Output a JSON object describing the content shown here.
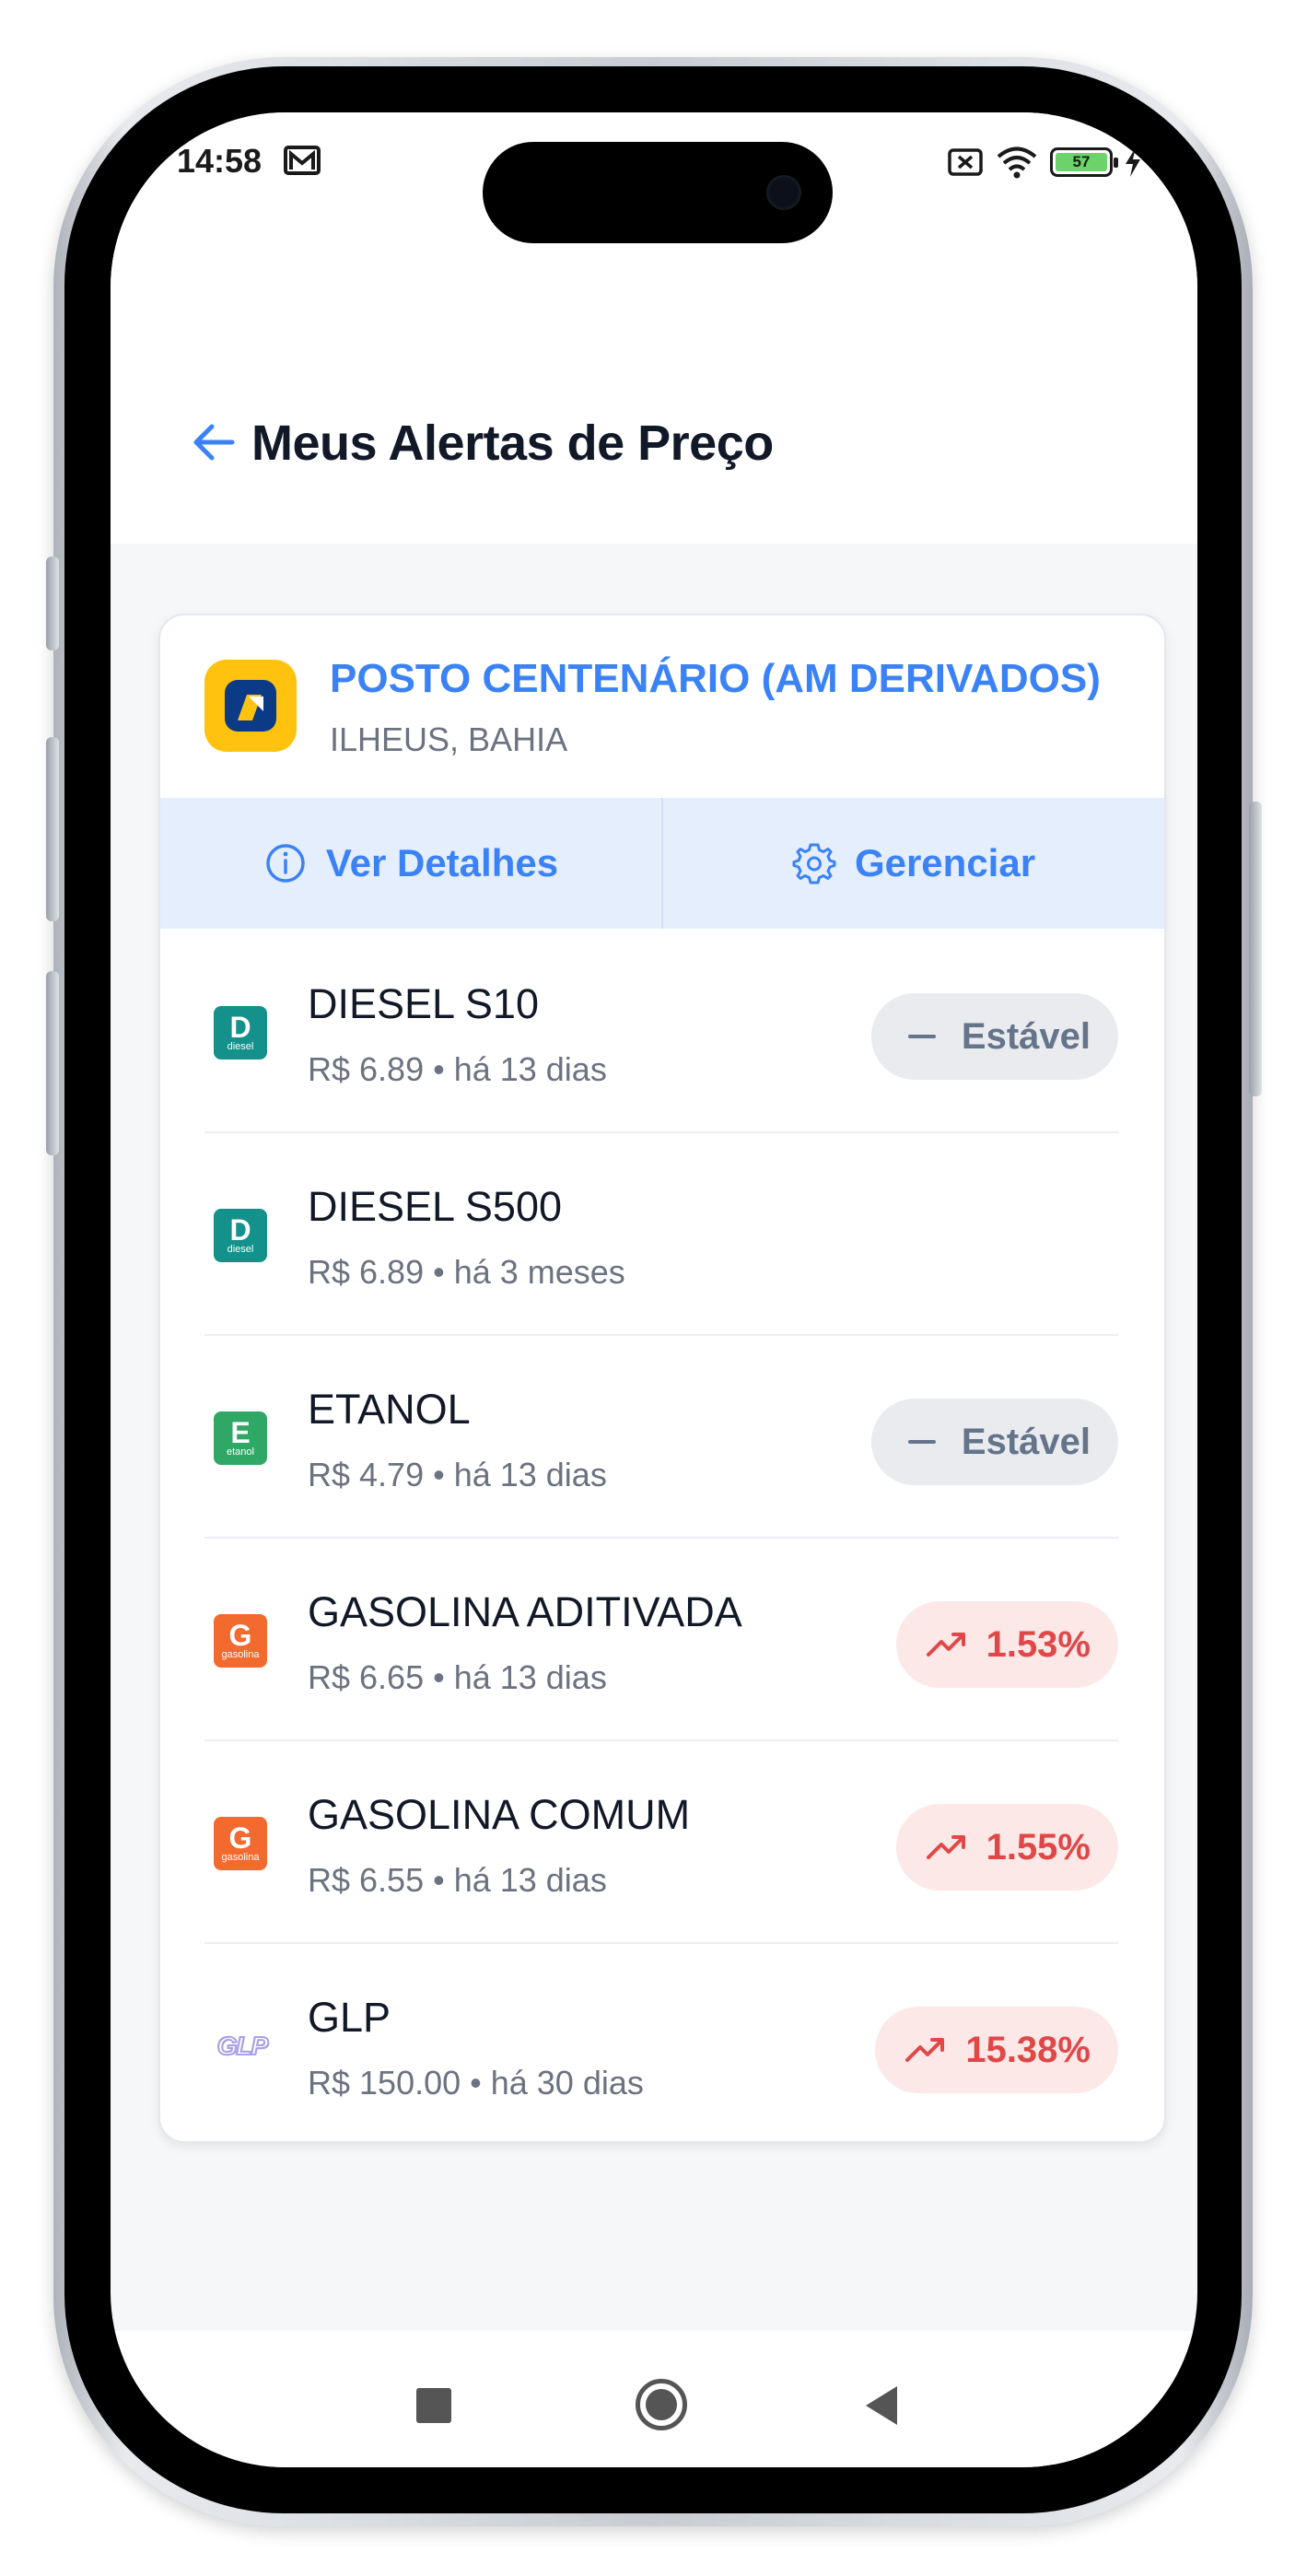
{
  "status_bar": {
    "time": "14:58",
    "battery_level": "57",
    "icons": [
      "mail-icon",
      "screen-cast-off-icon",
      "wifi-icon",
      "battery-icon",
      "charging-icon"
    ]
  },
  "header": {
    "title": "Meus Alertas de Preço",
    "back_icon": "arrow-left-icon"
  },
  "station": {
    "name": "POSTO CENTENÁRIO (AM DERIVADOS)",
    "location": "ILHEUS, BAHIA",
    "actions": {
      "details_label": "Ver Detalhes",
      "manage_label": "Gerenciar"
    }
  },
  "fuels": [
    {
      "name": "DIESEL S10",
      "meta": "R$ 6.89 • há 13 dias",
      "icon_letter": "D",
      "icon_sub": "diesel",
      "trend": "stable",
      "badge": "Estável"
    },
    {
      "name": "DIESEL S500",
      "meta": "R$ 6.89 • há 3 meses",
      "icon_letter": "D",
      "icon_sub": "diesel",
      "trend": "none",
      "badge": ""
    },
    {
      "name": "ETANOL",
      "meta": "R$ 4.79 • há 13 dias",
      "icon_letter": "E",
      "icon_sub": "etanol",
      "trend": "stable",
      "badge": "Estável"
    },
    {
      "name": "GASOLINA ADITIVADA",
      "meta": "R$ 6.65 • há 13 dias",
      "icon_letter": "G",
      "icon_sub": "gasolina",
      "trend": "up",
      "badge": "1.53%"
    },
    {
      "name": "GASOLINA COMUM",
      "meta": "R$ 6.55 • há 13 dias",
      "icon_letter": "G",
      "icon_sub": "gasolina",
      "trend": "up",
      "badge": "1.55%"
    },
    {
      "name": "GLP",
      "meta": "R$ 150.00 • há 30 dias",
      "icon_letter": "GLP",
      "icon_sub": "",
      "trend": "up",
      "badge": "15.38%"
    }
  ],
  "colors": {
    "accent": "#3b82f6",
    "diesel": "#13918a",
    "etanol": "#2fa865",
    "gasolina": "#f26a2e",
    "glp": "#a9a2e6",
    "up": "#e04848",
    "stable": "#64748b"
  }
}
